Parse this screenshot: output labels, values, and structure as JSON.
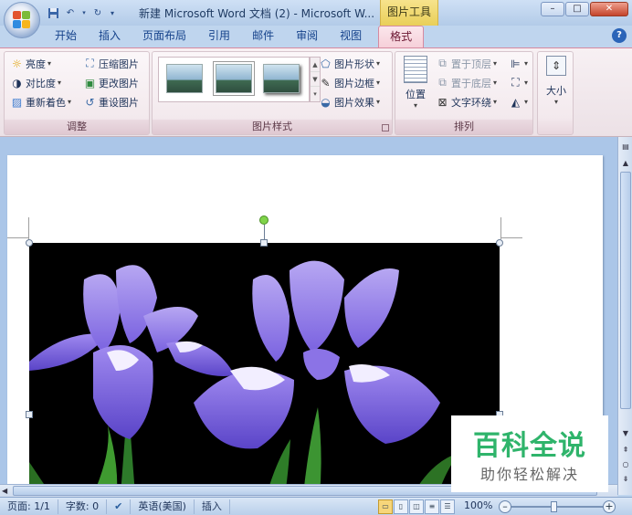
{
  "window": {
    "title": "新建 Microsoft Word 文档 (2) - Microsoft W...",
    "context_tab_label": "图片工具",
    "controls": {
      "minimize": "–",
      "maximize": "□",
      "close": "✕"
    }
  },
  "ribbon_tabs": [
    "开始",
    "插入",
    "页面布局",
    "引用",
    "邮件",
    "审阅",
    "视图",
    "格式"
  ],
  "active_tab": "格式",
  "groups": {
    "adjust": {
      "label": "调整",
      "items": [
        "亮度",
        "对比度",
        "重新着色",
        "压缩图片",
        "更改图片",
        "重设图片"
      ]
    },
    "picture_styles": {
      "label": "图片样式",
      "items": [
        "图片形状",
        "图片边框",
        "图片效果"
      ]
    },
    "arrange": {
      "label": "排列",
      "position_label": "位置",
      "items": [
        "置于顶层",
        "置于底层",
        "文字环绕"
      ]
    },
    "size": {
      "label": "大小"
    }
  },
  "status_bar": {
    "page": "页面: 1/1",
    "words": "字数: 0",
    "language": "英语(美国)",
    "mode": "插入",
    "zoom": "100%"
  },
  "watermark": {
    "line1": "百科全说",
    "line2": "助你轻松解决"
  },
  "colors": {
    "context_tab": "#e9cf59",
    "active_tab_border": "#d68aa0",
    "watermark_green": "#2fb46b"
  }
}
